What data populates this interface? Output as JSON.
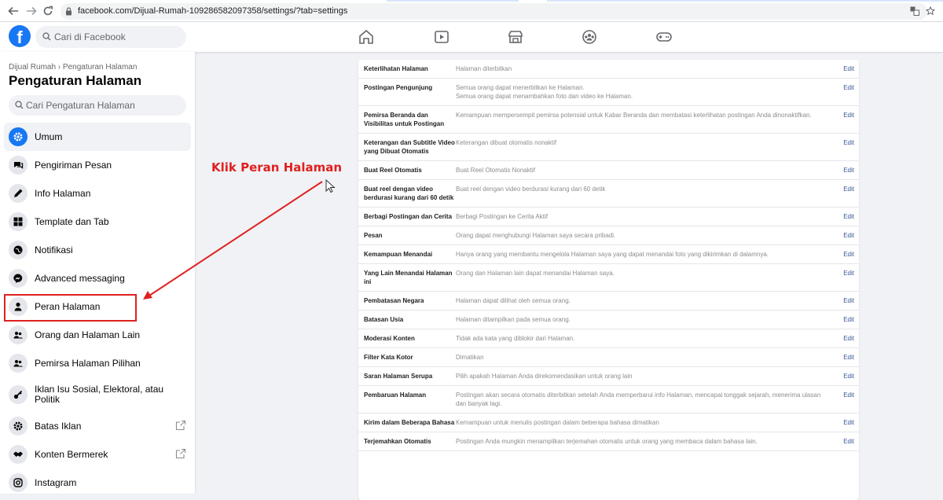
{
  "browser": {
    "url": "facebook.com/Dijual-Rumah-109286582097358/settings/?tab=settings"
  },
  "fb": {
    "search_placeholder": "Cari di Facebook"
  },
  "sidebar": {
    "breadcrumb": "Dijual Rumah › Pengaturan Halaman",
    "title": "Pengaturan Halaman",
    "search_placeholder": "Cari Pengaturan Halaman",
    "items": [
      {
        "label": "Umum",
        "icon": "gear-icon"
      },
      {
        "label": "Pengiriman Pesan",
        "icon": "chat-icon"
      },
      {
        "label": "Info Halaman",
        "icon": "pencil-icon"
      },
      {
        "label": "Template dan Tab",
        "icon": "grid-icon"
      },
      {
        "label": "Notifikasi",
        "icon": "globe-icon"
      },
      {
        "label": "Advanced messaging",
        "icon": "messenger-icon"
      },
      {
        "label": "Peran Halaman",
        "icon": "person-icon"
      },
      {
        "label": "Orang dan Halaman Lain",
        "icon": "people-icon"
      },
      {
        "label": "Pemirsa Halaman Pilihan",
        "icon": "people-icon"
      },
      {
        "label": "Iklan Isu Sosial, Elektoral, atau Politik",
        "icon": "key-icon"
      },
      {
        "label": "Batas Iklan",
        "icon": "gear-icon"
      },
      {
        "label": "Konten Bermerek",
        "icon": "handshake-icon"
      },
      {
        "label": "Instagram",
        "icon": "instagram-icon"
      }
    ]
  },
  "annotation": {
    "text": "Klik Peran Halaman",
    "color": "#e02020"
  },
  "settings": [
    {
      "key": "Keterlihatan Halaman",
      "value": "Halaman diterbitkan",
      "edit": "Edit"
    },
    {
      "key": "Postingan Pengunjung",
      "value": "Semua orang dapat menerbitkan ke Halaman.\nSemua orang dapat menambahkan foto dan video ke Halaman.",
      "edit": "Edit"
    },
    {
      "key": "Pemirsa Beranda dan Visibilitas untuk Postingan",
      "value": "Kemampuan mempersempit pemirsa potensial untuk Kabar Beranda dan membatasi keterlihatan postingan Anda dinonaktifkan.",
      "edit": "Edit"
    },
    {
      "key": "Keterangan dan Subtitle Video yang Dibuat Otomatis",
      "value": "Keterangan dibuat otomatis nonaktif",
      "edit": "Edit"
    },
    {
      "key": "Buat Reel Otomatis",
      "value": "Buat Reel Otomatis Nonaktif",
      "edit": "Edit"
    },
    {
      "key": "Buat reel dengan video berdurasi kurang dari 60 detik",
      "value": "Buat reel dengan video berdurasi kurang dari 60 detik",
      "edit": "Edit"
    },
    {
      "key": "Berbagi Postingan dan Cerita",
      "value": "Berbagi Postingan ke Cerita Aktif",
      "edit": "Edit"
    },
    {
      "key": "Pesan",
      "value": "Orang dapat menghubungi Halaman saya secara pribadi.",
      "edit": "Edit"
    },
    {
      "key": "Kemampuan Menandai",
      "value": "Hanya orang yang membantu mengelola Halaman saya yang dapat menandai foto yang dikirimkan di dalamnya.",
      "edit": "Edit"
    },
    {
      "key": "Yang Lain Menandai Halaman ini",
      "value": "Orang dan Halaman lain dapat menandai Halaman saya.",
      "edit": "Edit"
    },
    {
      "key": "Pembatasan Negara",
      "value": "Halaman dapat dilihat oleh semua orang.",
      "edit": "Edit"
    },
    {
      "key": "Batasan Usia",
      "value": "Halaman ditampilkan pada semua orang.",
      "edit": "Edit"
    },
    {
      "key": "Moderasi Konten",
      "value": "Tidak ada kata yang diblokir dari Halaman.",
      "edit": "Edit"
    },
    {
      "key": "Filter Kata Kotor",
      "value": "Dimatikan",
      "edit": "Edit"
    },
    {
      "key": "Saran Halaman Serupa",
      "value": "Pilih apakah Halaman Anda direkomendasikan untuk orang lain",
      "edit": "Edit"
    },
    {
      "key": "Pembaruan Halaman",
      "value": "Postingan akan secara otomatis diterbitkan setelah Anda memperbarui info Halaman, mencapai tonggak sejarah, menerima ulasan dan banyak lagi.",
      "edit": "Edit"
    },
    {
      "key": "Kirim dalam Beberapa Bahasa",
      "value": "Kemampuan untuk menulis postingan dalam beberapa bahasa dimatikan",
      "edit": "Edit"
    },
    {
      "key": "Terjemahkan Otomatis",
      "value": "Postingan Anda mungkin menampilkan terjemahan otomatis untuk orang yang membaca dalam bahasa lain.",
      "edit": "Edit"
    }
  ]
}
